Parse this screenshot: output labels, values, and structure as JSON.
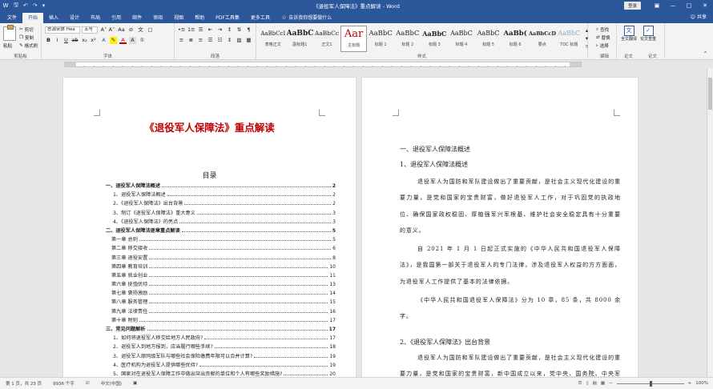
{
  "titlebar": {
    "title": "《退役军人保障法》重点解读 - Word",
    "login": "登录"
  },
  "tabs": [
    "文件",
    "开始",
    "插入",
    "设计",
    "布局",
    "引用",
    "邮件",
    "审阅",
    "视图",
    "帮助",
    "PDF工具集",
    "更多工具"
  ],
  "active_tab": "开始",
  "tell_me": "告诉我你想要做什么",
  "share": "共享",
  "ribbon": {
    "clipboard": {
      "paste": "粘贴",
      "cut": "剪切",
      "copy": "复制",
      "format_painter": "格式刷",
      "label": "剪贴板"
    },
    "font": {
      "name": "思源宋体 Hea",
      "size": "五号",
      "label": "字体"
    },
    "paragraph": {
      "label": "段落"
    },
    "styles": {
      "label": "样式",
      "items": [
        {
          "preview": "AaBbCcI",
          "name": "表格正文"
        },
        {
          "preview": "AaBbC",
          "name": "副标题1"
        },
        {
          "preview": "AaBbCc",
          "name": "正文1"
        },
        {
          "preview": "Aar",
          "name": "主标题"
        },
        {
          "preview": "AaBbC",
          "name": "标题 1"
        },
        {
          "preview": "AaBbC",
          "name": "标题 2"
        },
        {
          "preview": "AaBbC",
          "name": "标题 3"
        },
        {
          "preview": "AaBbC",
          "name": "标题 4"
        },
        {
          "preview": "AaBbC",
          "name": "标题 5"
        },
        {
          "preview": "AaBb(",
          "name": "标题 6"
        },
        {
          "preview": "AaBbCcD",
          "name": "要点"
        },
        {
          "preview": "AaBbC",
          "name": "TOC 标题"
        }
      ]
    },
    "editing": {
      "find": "查找",
      "replace": "替换",
      "select": "选择",
      "label": "编辑"
    },
    "check": {
      "button": "全文翻译",
      "label": "论文"
    },
    "check2": {
      "button": "论文查重",
      "label": "论文"
    }
  },
  "left_page": {
    "title": "《退役军人保障法》重点解读",
    "toc_title": "目录",
    "toc": [
      {
        "level": 1,
        "text": "一、退役军人保障法概述",
        "page": "2"
      },
      {
        "level": 2,
        "text": "1、退役军人保障法概述",
        "page": "2"
      },
      {
        "level": 2,
        "text": "2、《退役军人保障法》出台背景",
        "page": "2"
      },
      {
        "level": 2,
        "text": "3、制订《退役军人保障法》重大意义",
        "page": "3"
      },
      {
        "level": 2,
        "text": "4、《退役军人保障法》的亮点",
        "page": "3"
      },
      {
        "level": 1,
        "text": "二、退役军人保障法逐章重点解读",
        "page": "5"
      },
      {
        "level": 3,
        "text": "第一章  总则",
        "page": "5"
      },
      {
        "level": 3,
        "text": "第二章  移交接收",
        "page": "6"
      },
      {
        "level": 3,
        "text": "第三章  退役安置",
        "page": "8"
      },
      {
        "level": 3,
        "text": "第四章  教育培训",
        "page": "10"
      },
      {
        "level": 3,
        "text": "第五章  就业创业",
        "page": "11"
      },
      {
        "level": 3,
        "text": "第六章  抚恤优待",
        "page": "13"
      },
      {
        "level": 3,
        "text": "第七章  褒扬激励",
        "page": "14"
      },
      {
        "level": 3,
        "text": "第八章  服务管理",
        "page": "15"
      },
      {
        "level": 3,
        "text": "第九章  法律责任",
        "page": "16"
      },
      {
        "level": 3,
        "text": "第十章  附则",
        "page": "17"
      },
      {
        "level": 1,
        "text": "三、常见问题解析",
        "page": "17"
      },
      {
        "level": 2,
        "text": "1、如何将退役军人移交给地方人民政府?",
        "page": "17"
      },
      {
        "level": 2,
        "text": "2、退役军人到地方报到，应当履行哪些手续?",
        "page": "18"
      },
      {
        "level": 2,
        "text": "3、退役军人原同级军队与哪些社会保险缴费年限可以合并计算?",
        "page": "19"
      },
      {
        "level": 2,
        "text": "4、医疗机构为退役军人提供哪些优待?",
        "page": "19"
      },
      {
        "level": 2,
        "text": "5、国家对在退役军人保障工作中做出突出贡献的单位和个人有哪些奖励措施?",
        "page": "20"
      }
    ]
  },
  "right_page": {
    "h1": "一、退役军人保障法概述",
    "h2a": "1、退役军人保障法概述",
    "p1": "退役军人为国防和军队建设做出了重要贡献，是社会主义现代化建设的重要力量，是党和国家的宝贵财富，做好退役军人工作，对于巩固党的执政地位、确保国家政权稳固、厚植强军兴军根基、维护社会安全稳定具有十分重要的意义。",
    "p2": "自 2021 年 1 月 1 日起正式实施的《中华人民共和国退役军人保障法》，是我国第一部关于退役军人的专门法律，涉及退役军人权益的方方面面，为退役军人工作提供了基本的法律依据。",
    "p3": "《中华人民共和国退役军人保障法》分为 10 章，85 条，共 8000 余字。",
    "h2b": "2、《退役军人保障法》出台背景",
    "p4": "退役军人为国防和军队建设做出了重要贡献，是社会主义现代化建设的重要力量，是党和国家的宝贵财富，新中国成立以来，党中央、国务院、中央军委制定了一系列政策法规，对维护退役军人权益"
  },
  "status": {
    "page": "第 1 页，共 23 页",
    "words": "9936 个字",
    "lang": "中文(中国)",
    "zoom": "100%"
  },
  "float_widget": {
    "label": "中"
  },
  "colors": {
    "brand": "#2b579a",
    "title_red": "#c00000"
  }
}
